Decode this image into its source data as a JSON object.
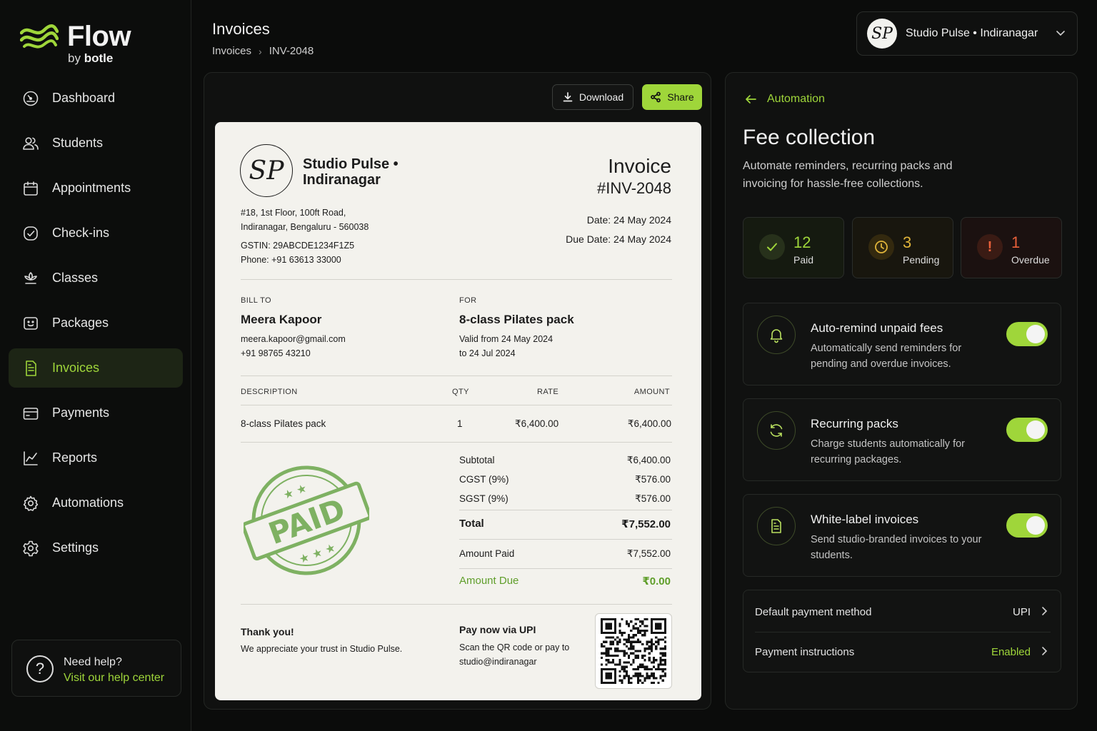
{
  "brand": {
    "name": "Flow",
    "sub_prefix": "by",
    "sub_name": "botle"
  },
  "nav": [
    {
      "label": "Dashboard",
      "icon": "dashboard-icon"
    },
    {
      "label": "Students",
      "icon": "users-icon"
    },
    {
      "label": "Appointments",
      "icon": "calendar-icon"
    },
    {
      "label": "Check-ins",
      "icon": "check-circle-icon"
    },
    {
      "label": "Classes",
      "icon": "lotus-icon"
    },
    {
      "label": "Packages",
      "icon": "package-icon"
    },
    {
      "label": "Invoices",
      "icon": "invoice-icon",
      "active": true
    },
    {
      "label": "Payments",
      "icon": "wallet-icon"
    },
    {
      "label": "Reports",
      "icon": "chart-icon"
    },
    {
      "label": "Automations",
      "icon": "gear-icon"
    },
    {
      "label": "Settings",
      "icon": "settings-icon"
    }
  ],
  "help": {
    "title": "Need help?",
    "link": "Visit our help center"
  },
  "header": {
    "title": "Invoices",
    "breadcrumb": [
      "Invoices",
      "INV-2048"
    ],
    "studio": "Studio Pulse • Indiranagar"
  },
  "toolbar": {
    "download": "Download",
    "share": "Share"
  },
  "invoice": {
    "logo_text": "SP",
    "studio": "Studio Pulse • Indiranagar",
    "title": "Invoice",
    "number": "#INV-2048",
    "address_1": "#18, 1st Floor, 100ft Road,",
    "address_2": "Indiranagar, Bengaluru - 560038",
    "gstin": "GSTIN: 29ABCDE1234F1Z5",
    "phone": "Phone: +91 63613 33000",
    "date": "Date: 24 May 2024",
    "due_date": "Due Date: 24 May 2024",
    "bill_to_label": "BILL TO",
    "bill_name": "Meera Kapoor",
    "bill_email": "meera.kapoor@gmail.com",
    "bill_phone": "+91 98765 43210",
    "for_label": "FOR",
    "for_name": "8-class Pilates pack",
    "valid_1": "Valid from 24 May 2024",
    "valid_2": "to 24 Jul 2024",
    "columns": {
      "description": "DESCRIPTION",
      "qty": "QTY",
      "rate": "RATE",
      "amount": "AMOUNT"
    },
    "line": {
      "description": "8-class Pilates pack",
      "qty": "1",
      "rate": "₹6,400.00",
      "amount": "₹6,400.00"
    },
    "subtotal_label": "Subtotal",
    "subtotal": "₹6,400.00",
    "cgst_label": "CGST (9%)",
    "cgst": "₹576.00",
    "sgst_label": "SGST (9%)",
    "sgst": "₹576.00",
    "total_label": "Total",
    "total": "₹7,552.00",
    "paid_label": "Amount Paid",
    "paid": "₹7,552.00",
    "due_label": "Amount Due",
    "due": "₹0.00",
    "stamp": "PAID",
    "thanks": "Thank you!",
    "thanks_note": "We appreciate your trust in Studio Pulse.",
    "upi_title": "Pay now via UPI",
    "upi_note": "Scan the QR code or pay to studio@indiranagar"
  },
  "automation": {
    "back": "Automation",
    "title": "Fee collection",
    "description": "Automate reminders, recurring packs and invoicing for hassle-free collections.",
    "stats": [
      {
        "count": "12",
        "label": "Paid",
        "icon": "check-icon",
        "color": "#9fd63a"
      },
      {
        "count": "3",
        "label": "Pending",
        "icon": "clock-icon",
        "color": "#e0b43a"
      },
      {
        "count": "1",
        "label": "Overdue",
        "icon": "alert-icon",
        "color": "#e8603a"
      }
    ],
    "cards": [
      {
        "title": "Auto-remind unpaid fees",
        "desc": "Automatically send reminders for pending and overdue invoices.",
        "icon": "bell-icon",
        "enabled": true
      },
      {
        "title": "Recurring packs",
        "desc": "Charge students automatically for recurring packages.",
        "icon": "refresh-icon",
        "enabled": true
      },
      {
        "title": "White-label invoices",
        "desc": "Send studio-branded invoices to your students.",
        "icon": "document-icon",
        "enabled": true
      }
    ],
    "options": [
      {
        "label": "Default payment method",
        "value": "UPI"
      },
      {
        "label": "Payment instructions",
        "value": "Enabled"
      }
    ]
  }
}
